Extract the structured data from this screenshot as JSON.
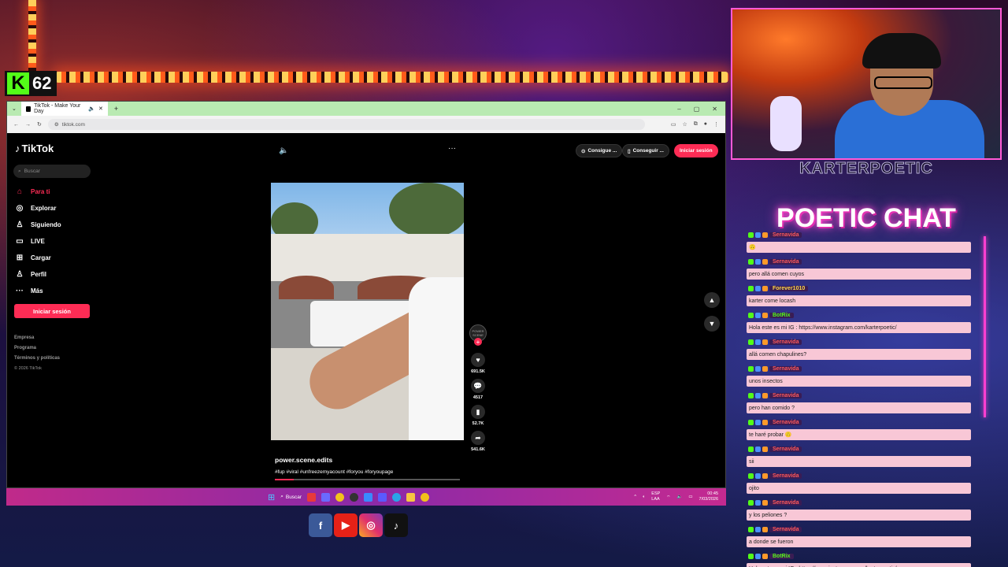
{
  "overlay": {
    "kick_count": "62",
    "streamer_name": "KARTERPOETIC",
    "chat_title": "POETIC CHAT",
    "social": [
      "f",
      "▶",
      "◎",
      "♪"
    ]
  },
  "browser": {
    "tab_title": "TikTok - Make Your Day",
    "new_tab": "+",
    "url": "tiktok.com",
    "window_controls": [
      "–",
      "▢",
      "✕"
    ]
  },
  "tiktok": {
    "logo": "TikTok",
    "search_placeholder": "Buscar",
    "nav": [
      {
        "icon": "⌂",
        "label": "Para ti"
      },
      {
        "icon": "◎",
        "label": "Explorar"
      },
      {
        "icon": "♙",
        "label": "Siguiendo"
      },
      {
        "icon": "▭",
        "label": "LIVE"
      },
      {
        "icon": "⊞",
        "label": "Cargar"
      },
      {
        "icon": "♙",
        "label": "Perfil"
      },
      {
        "icon": "···",
        "label": "Más"
      }
    ],
    "login_button": "Iniciar sesión",
    "footer": [
      "Empresa",
      "Programa",
      "Términos y políticas",
      "© 2026 TikTok"
    ],
    "top_buttons": {
      "coin": "Consigue ...",
      "app": "Conseguir ...",
      "login": "Iniciar sesión"
    },
    "video": {
      "author": "power.scene.edits",
      "caption": "#fup #viral #unfreezemyacount #foryou #foryoupage",
      "avatar_text": "POWER SCENE",
      "likes": "691.5K",
      "comments": "4517",
      "saves": "52.7K",
      "shares": "541.6K",
      "progress_fraction": 0.1
    }
  },
  "taskbar": {
    "search_label": "Buscar",
    "lang_top": "ESP",
    "lang_bottom": "LAA",
    "time": "00:45",
    "date": "7/03/2026"
  },
  "chat": [
    {
      "user": "Sernavida",
      "user_color": "#ff5a5a",
      "text": "🙃"
    },
    {
      "user": "Sernavida",
      "user_color": "#ff5a5a",
      "text": "pero allá comen cuyos"
    },
    {
      "user": "Forever1010",
      "user_color": "#ffd84a",
      "text": "karter come locash"
    },
    {
      "user": "BotRix",
      "user_color": "#53fc18",
      "text": "Hola este es mi IG : https://www.instagram.com/karterpoetic/"
    },
    {
      "user": "Sernavida",
      "user_color": "#ff5a5a",
      "text": "allá comen chapulines?"
    },
    {
      "user": "Sernavida",
      "user_color": "#ff5a5a",
      "text": "unos insectos"
    },
    {
      "user": "Sernavida",
      "user_color": "#ff5a5a",
      "text": "pero han comido ?"
    },
    {
      "user": "Sernavida",
      "user_color": "#ff5a5a",
      "text": "te haré probar 🙃"
    },
    {
      "user": "Sernavida",
      "user_color": "#ff5a5a",
      "text": "sii"
    },
    {
      "user": "Sernavida",
      "user_color": "#ff5a5a",
      "text": "ojito"
    },
    {
      "user": "Sernavida",
      "user_color": "#ff5a5a",
      "text": "y los peliones ?"
    },
    {
      "user": "Sernavida",
      "user_color": "#ff5a5a",
      "text": "a donde se fueron"
    },
    {
      "user": "BotRix",
      "user_color": "#53fc18",
      "text": "Hola este es mi IG : https://www.instagram.com/karterpoetic/"
    }
  ],
  "colors": {
    "tiktok_red": "#fe2c55",
    "kick_green": "#53fc18",
    "neon_pink": "#ff4ad0",
    "chat_bubble": "#f8c7d6"
  }
}
